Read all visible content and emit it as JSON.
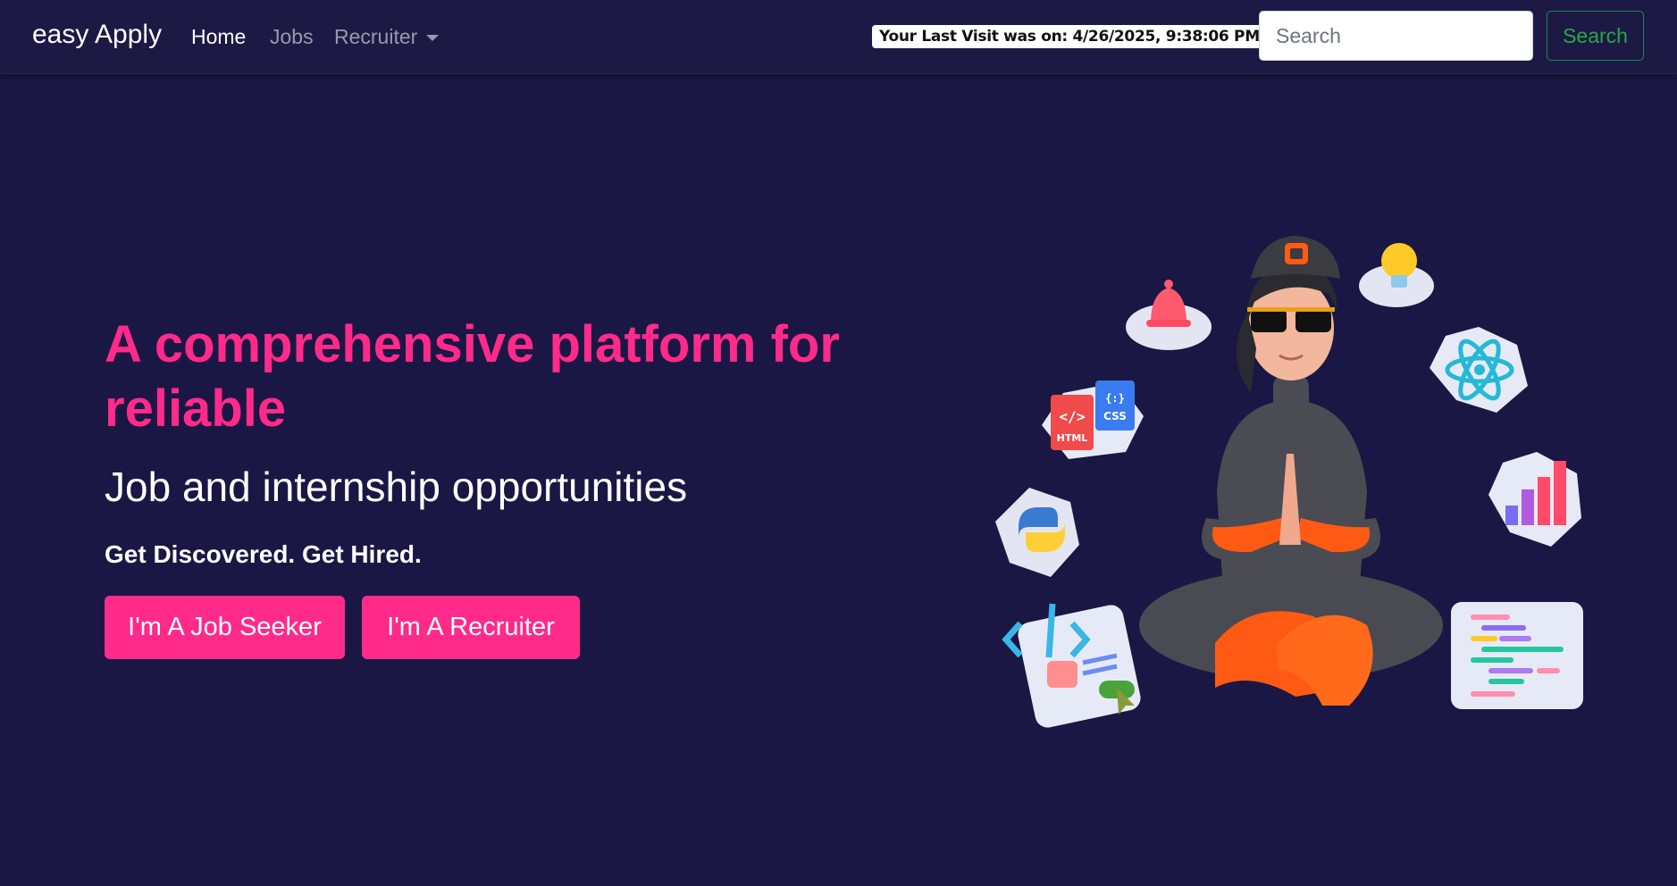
{
  "navbar": {
    "brand": "easy Apply",
    "links": [
      {
        "label": "Home",
        "active": true
      },
      {
        "label": "Jobs",
        "active": false
      },
      {
        "label": "Recruiter",
        "active": false,
        "dropdown": true
      }
    ],
    "last_visit": "Your Last Visit was on: 4/26/2025, 9:38:06 PM",
    "search": {
      "placeholder": "Search",
      "value": "",
      "button_label": "Search"
    }
  },
  "hero": {
    "title": "A comprehensive platform for reliable",
    "subtitle": "Job and internship opportunities",
    "tagline": "Get Discovered. Get Hired.",
    "buttons": {
      "job_seeker": "I'm A Job Seeker",
      "recruiter": "I'm A Recruiter"
    }
  },
  "illustration": {
    "html_badge": "HTML",
    "css_badge": "CSS"
  },
  "colors": {
    "background": "#1a1744",
    "accent": "#ff2a8a",
    "search_button": "#28a745"
  }
}
